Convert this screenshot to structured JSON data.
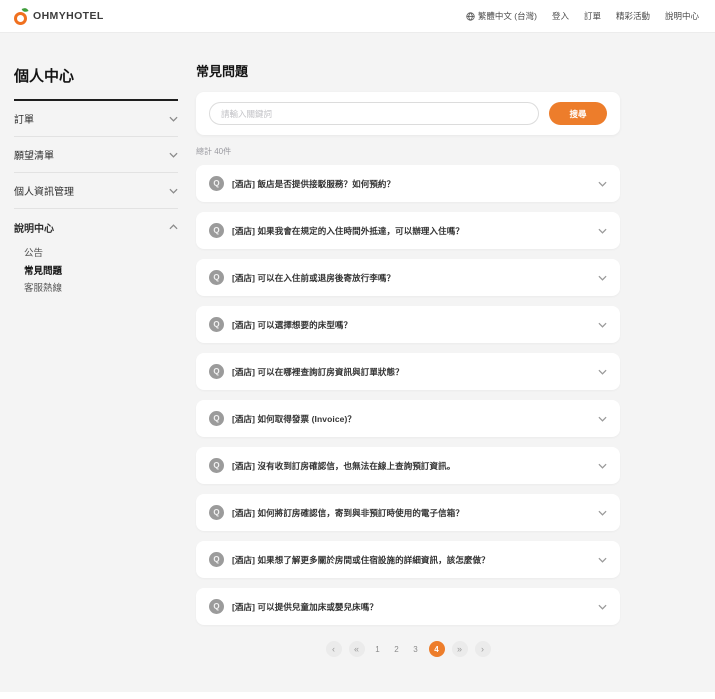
{
  "colors": {
    "accent": "#ED7D2B",
    "page_bg": "#f4f4f4"
  },
  "header": {
    "logo_text": "OHMYHOTEL",
    "nav": [
      {
        "label": "繁體中文 (台灣)",
        "icon": "globe-icon"
      },
      {
        "label": "登入"
      },
      {
        "label": "訂單"
      },
      {
        "label": "精彩活動"
      },
      {
        "label": "說明中心"
      }
    ]
  },
  "sidebar": {
    "title": "個人中心",
    "items": [
      {
        "label": "訂單",
        "state": "collapsed"
      },
      {
        "label": "願望清單",
        "state": "collapsed"
      },
      {
        "label": "個人資訊管理",
        "state": "collapsed"
      },
      {
        "label": "說明中心",
        "state": "expanded"
      }
    ],
    "subitems": [
      {
        "label": "公告",
        "active": false
      },
      {
        "label": "常見問題",
        "active": true
      },
      {
        "label": "客服熱線",
        "active": false
      }
    ]
  },
  "main": {
    "title": "常見問題",
    "search": {
      "placeholder": "請輸入關鍵詞",
      "button_label": "搜尋"
    },
    "total_label": "總計 40件",
    "q_icon_glyph": "Q",
    "faqs": [
      "[酒店] 飯店是否提供接駁服務？如何預約？",
      "[酒店] 如果我會在規定的入住時間外抵達，可以辦理入住嗎？",
      "[酒店] 可以在入住前或退房後寄放行李嗎？",
      "[酒店] 可以選擇想要的床型嗎？",
      "[酒店] 可以在哪裡查詢訂房資訊與訂單狀態？",
      "[酒店] 如何取得發票 (Invoice)？",
      "[酒店] 沒有收到訂房確認信，也無法在線上查詢預訂資訊。",
      "[酒店] 如何將訂房確認信，寄到與非預訂時使用的電子信箱？",
      "[酒店] 如果想了解更多關於房間或住宿設施的詳細資訊，該怎麼做？",
      "[酒店] 可以提供兒童加床或嬰兒床嗎？"
    ],
    "pagination": {
      "prev": "‹",
      "jump_back": "«",
      "pages": [
        "1",
        "2",
        "3"
      ],
      "current_page": "4",
      "jump_forward": "»",
      "next": "›"
    }
  }
}
